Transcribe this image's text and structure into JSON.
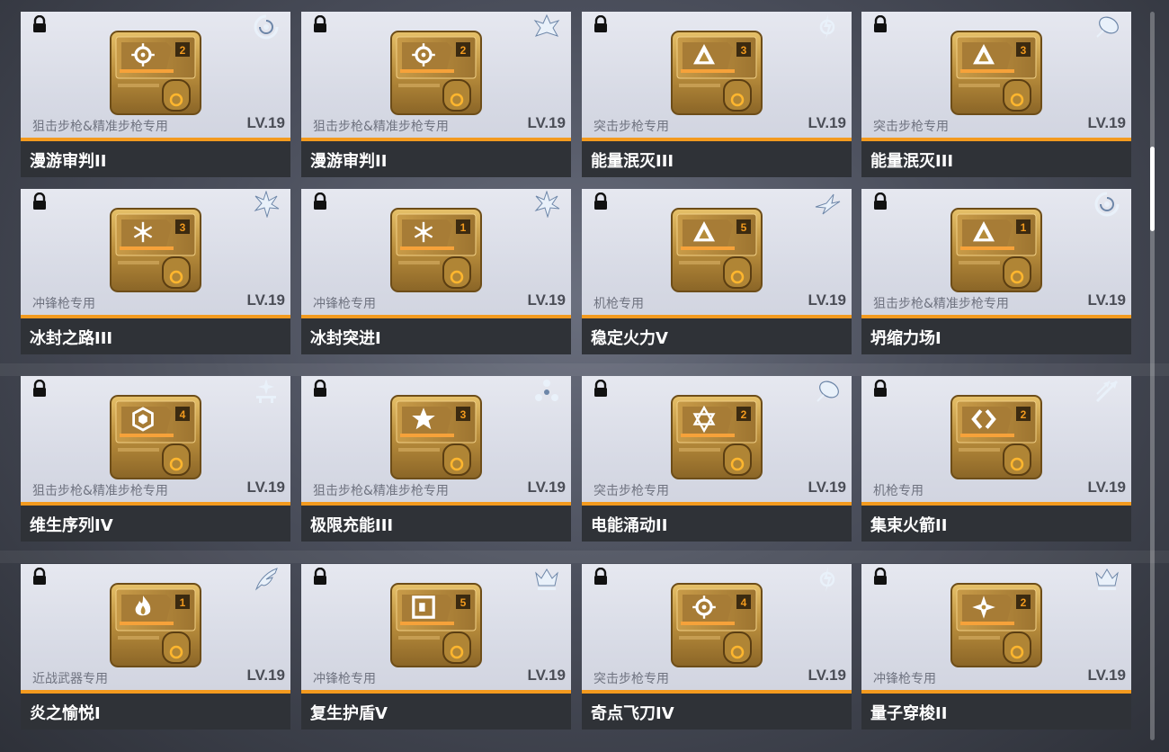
{
  "cards": [
    {
      "name": "漫游审判II",
      "weapon": "狙击步枪&精准步枪专用",
      "level": "LV.19",
      "rank": "2",
      "symbol": "target",
      "element": "swirl-icon"
    },
    {
      "name": "漫游审判II",
      "weapon": "狙击步枪&精准步枪专用",
      "level": "LV.19",
      "rank": "2",
      "symbol": "target",
      "element": "flame-burst-icon"
    },
    {
      "name": "能量泯灭III",
      "weapon": "突击步枪专用",
      "level": "LV.19",
      "rank": "3",
      "symbol": "triangle",
      "element": "lightning-orb-icon"
    },
    {
      "name": "能量泯灭III",
      "weapon": "突击步枪专用",
      "level": "LV.19",
      "rank": "3",
      "symbol": "triangle",
      "element": "comet-icon"
    },
    {
      "name": "冰封之路III",
      "weapon": "冲锋枪专用",
      "level": "LV.19",
      "rank": "3",
      "symbol": "snowflake",
      "element": "ice-shard-icon"
    },
    {
      "name": "冰封突进I",
      "weapon": "冲锋枪专用",
      "level": "LV.19",
      "rank": "1",
      "symbol": "snowflake",
      "element": "ice-shard-icon"
    },
    {
      "name": "稳定火力V",
      "weapon": "机枪专用",
      "level": "LV.19",
      "rank": "5",
      "symbol": "triangle",
      "element": "bird-icon"
    },
    {
      "name": "坍缩力场I",
      "weapon": "狙击步枪&精准步枪专用",
      "level": "LV.19",
      "rank": "1",
      "symbol": "triangle",
      "element": "swirl-icon"
    },
    {
      "name": "维生序列IV",
      "weapon": "狙击步枪&精准步枪专用",
      "level": "LV.19",
      "rank": "4",
      "symbol": "hexagon",
      "element": "sparkle-icon"
    },
    {
      "name": "极限充能III",
      "weapon": "狙击步枪&精准步枪专用",
      "level": "LV.19",
      "rank": "3",
      "symbol": "star",
      "element": "triad-icon"
    },
    {
      "name": "电能涌动II",
      "weapon": "突击步枪专用",
      "level": "LV.19",
      "rank": "2",
      "symbol": "hexagram",
      "element": "comet-icon"
    },
    {
      "name": "集束火箭II",
      "weapon": "机枪专用",
      "level": "LV.19",
      "rank": "2",
      "symbol": "chevrons",
      "element": "arrows-icon"
    },
    {
      "name": "炎之愉悦I",
      "weapon": "近战武器专用",
      "level": "LV.19",
      "rank": "1",
      "symbol": "flame",
      "element": "feather-icon"
    },
    {
      "name": "复生护盾V",
      "weapon": "冲锋枪专用",
      "level": "LV.19",
      "rank": "5",
      "symbol": "square",
      "element": "crown-icon"
    },
    {
      "name": "奇点飞刀IV",
      "weapon": "突击步枪专用",
      "level": "LV.19",
      "rank": "4",
      "symbol": "target",
      "element": "lightning-orb-icon"
    },
    {
      "name": "量子穿梭II",
      "weapon": "冲锋枪专用",
      "level": "LV.19",
      "rank": "2",
      "symbol": "shuriken",
      "element": "crown-icon"
    }
  ],
  "colors": {
    "accent_bar": "#f39a1e",
    "name_bar": "#2f3237",
    "card_bg": "#dcdfe8",
    "chip_gold": "#c9a24a",
    "rank_badge": "#f08a1c"
  }
}
